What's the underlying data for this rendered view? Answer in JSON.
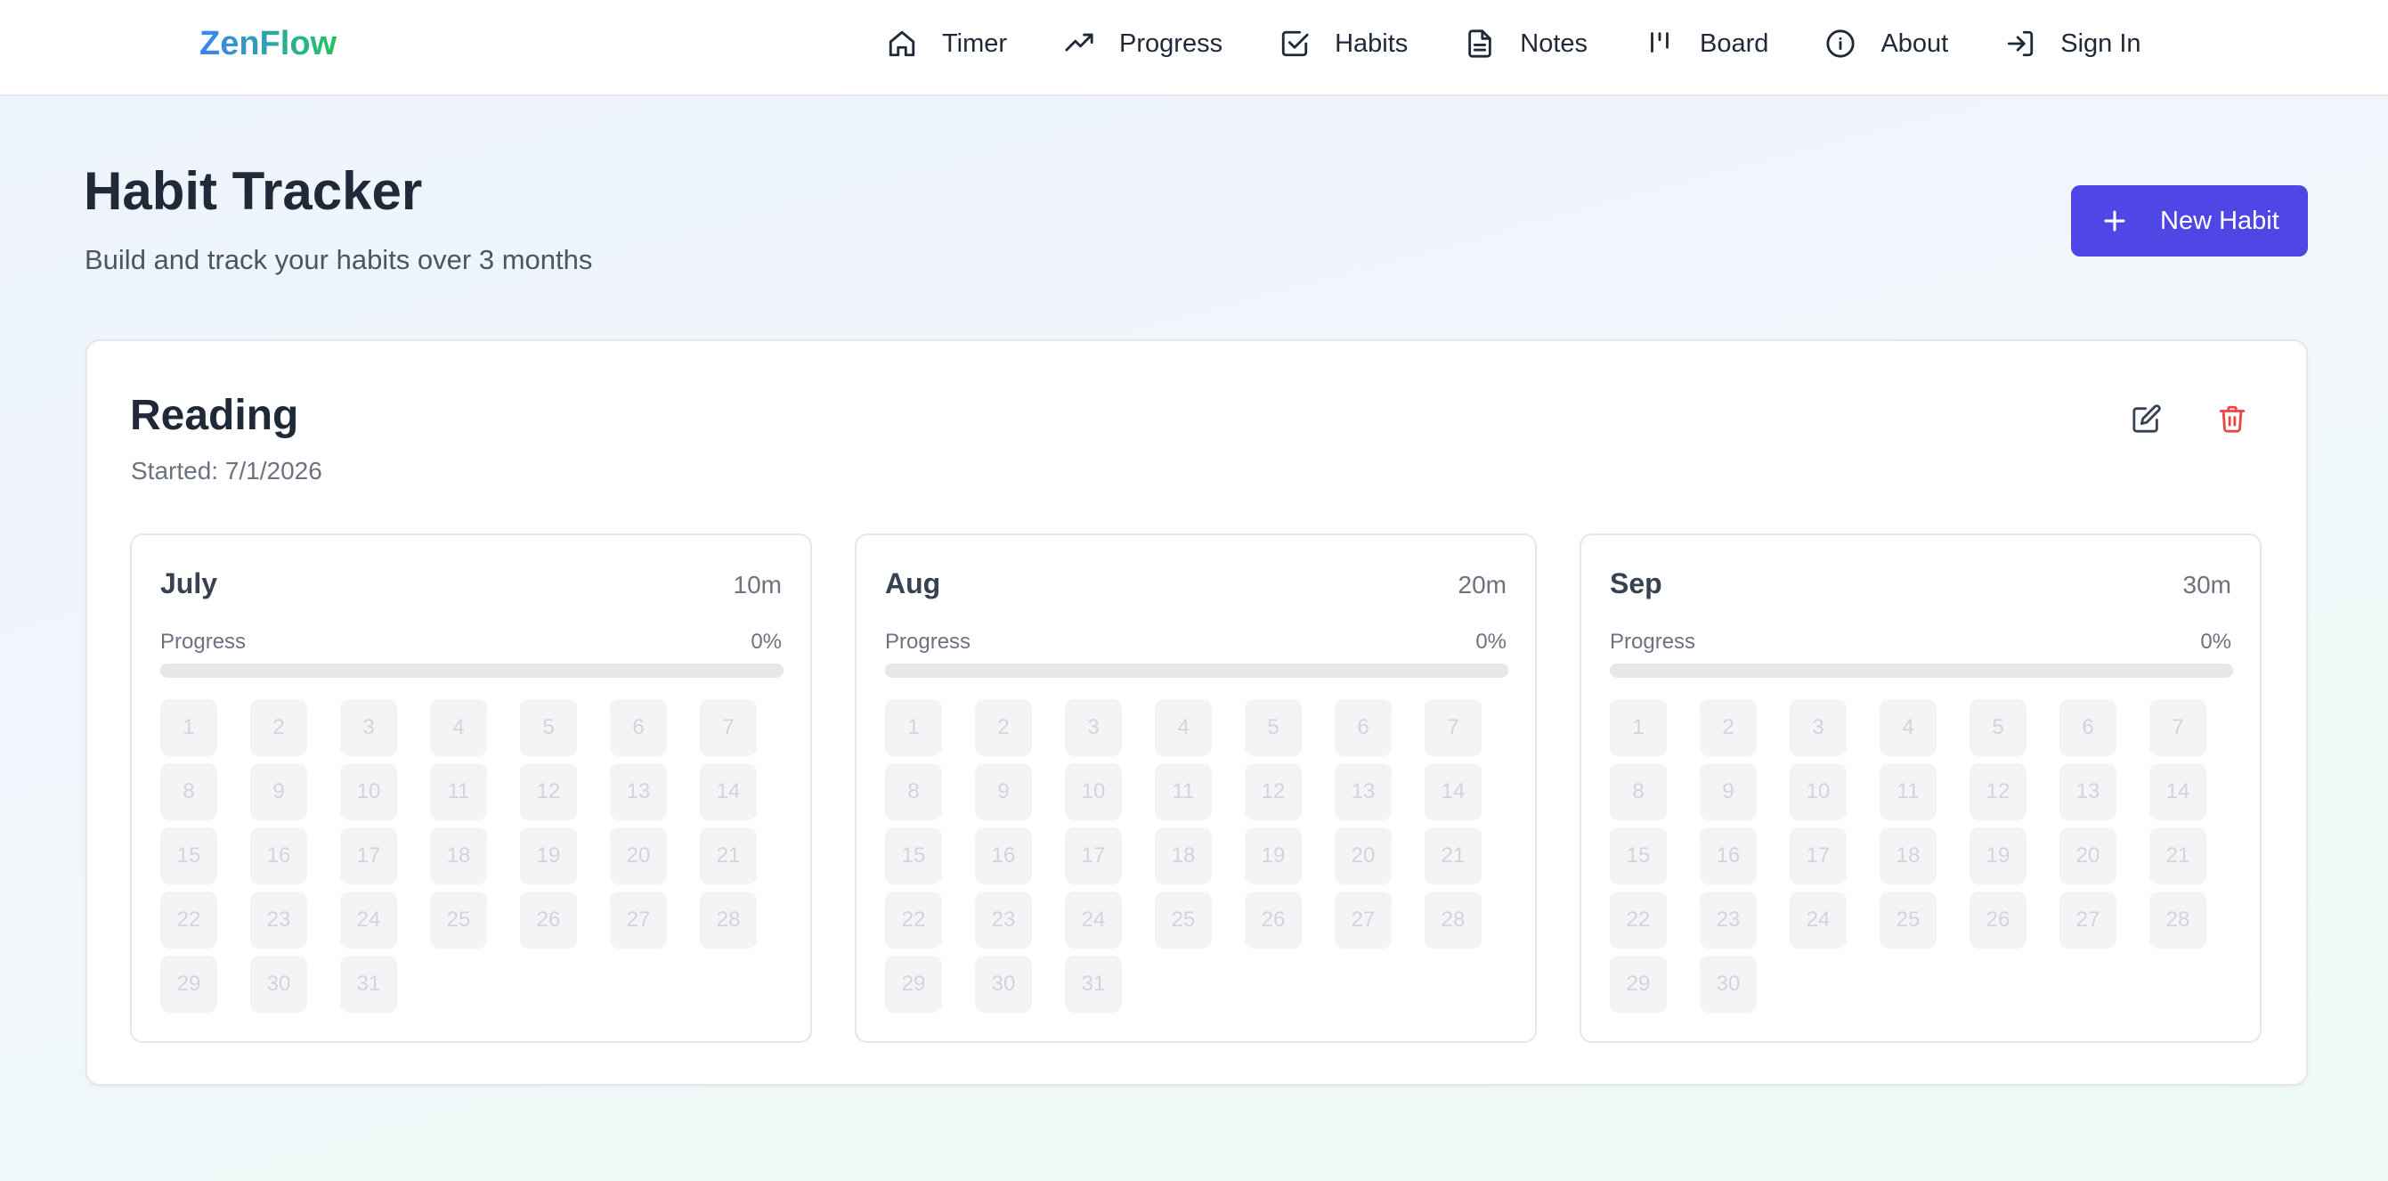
{
  "brand": "ZenFlow",
  "nav": [
    {
      "label": "Timer",
      "icon": "home-icon"
    },
    {
      "label": "Progress",
      "icon": "trending-up-icon"
    },
    {
      "label": "Habits",
      "icon": "checkbox-icon"
    },
    {
      "label": "Notes",
      "icon": "file-text-icon"
    },
    {
      "label": "Board",
      "icon": "kanban-icon"
    },
    {
      "label": "About",
      "icon": "info-icon"
    },
    {
      "label": "Sign In",
      "icon": "sign-in-icon"
    }
  ],
  "header": {
    "title": "Habit Tracker",
    "subtitle": "Build and track your habits over 3 months",
    "new_habit_label": "New Habit"
  },
  "habit": {
    "name": "Reading",
    "started": "Started: 7/1/2026",
    "months": [
      {
        "name": "July",
        "duration": "10m",
        "progress_label": "Progress",
        "progress_text": "0%",
        "progress": 0,
        "days": 31
      },
      {
        "name": "Aug",
        "duration": "20m",
        "progress_label": "Progress",
        "progress_text": "0%",
        "progress": 0,
        "days": 31
      },
      {
        "name": "Sep",
        "duration": "30m",
        "progress_label": "Progress",
        "progress_text": "0%",
        "progress": 0,
        "days": 30
      }
    ]
  },
  "colors": {
    "accent": "#4f46e5",
    "brand_gradient_start": "#3b82f6",
    "brand_gradient_end": "#22c55e",
    "delete": "#ef4444"
  }
}
